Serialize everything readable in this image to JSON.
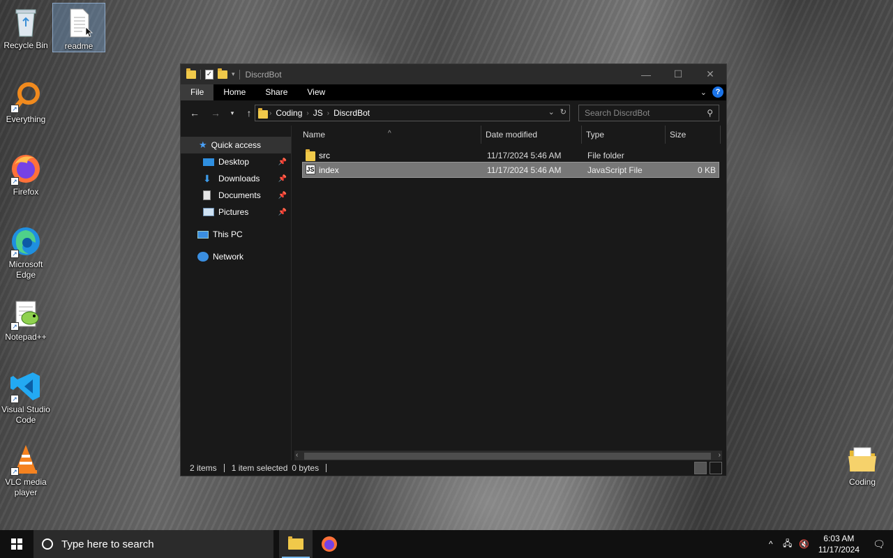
{
  "desktop": {
    "icons": [
      {
        "label": "Recycle Bin",
        "icon": "recycle-bin-icon"
      },
      {
        "label": "readme",
        "icon": "text-document-icon"
      },
      {
        "label": "Everything",
        "icon": "everything-search-icon"
      },
      {
        "label": "Firefox",
        "icon": "firefox-icon"
      },
      {
        "label": "Microsoft Edge",
        "icon": "edge-icon"
      },
      {
        "label": "Notepad++",
        "icon": "notepadpp-icon"
      },
      {
        "label": "Visual Studio Code",
        "icon": "vscode-icon"
      },
      {
        "label": "VLC media player",
        "icon": "vlc-icon"
      },
      {
        "label": "Coding",
        "icon": "folder-icon"
      }
    ]
  },
  "explorer": {
    "title": "DiscrdBot",
    "ribbon_tabs": [
      "File",
      "Home",
      "Share",
      "View"
    ],
    "address": {
      "crumbs": [
        "Coding",
        "JS",
        "DiscrdBot"
      ]
    },
    "search": {
      "placeholder": "Search DiscrdBot"
    },
    "nav": {
      "quick_access": "Quick access",
      "items": [
        {
          "label": "Desktop",
          "pinned": true
        },
        {
          "label": "Downloads",
          "pinned": true
        },
        {
          "label": "Documents",
          "pinned": true
        },
        {
          "label": "Pictures",
          "pinned": true
        }
      ],
      "this_pc": "This PC",
      "network": "Network"
    },
    "columns": {
      "name": "Name",
      "date": "Date modified",
      "type": "Type",
      "size": "Size"
    },
    "files": [
      {
        "name": "src",
        "date": "11/17/2024 5:46 AM",
        "type": "File folder",
        "size": "",
        "selected": false
      },
      {
        "name": "index",
        "date": "11/17/2024 5:46 AM",
        "type": "JavaScript File",
        "size": "0 KB",
        "selected": true
      }
    ],
    "status": {
      "items": "2 items",
      "selected": "1 item selected",
      "bytes": "0 bytes"
    }
  },
  "taskbar": {
    "search_placeholder": "Type here to search",
    "time": "6:03 AM",
    "date": "11/17/2024"
  },
  "colors": {
    "accent": "#76b9ed",
    "help": "#1a73e8",
    "folder": "#f0c94a"
  }
}
